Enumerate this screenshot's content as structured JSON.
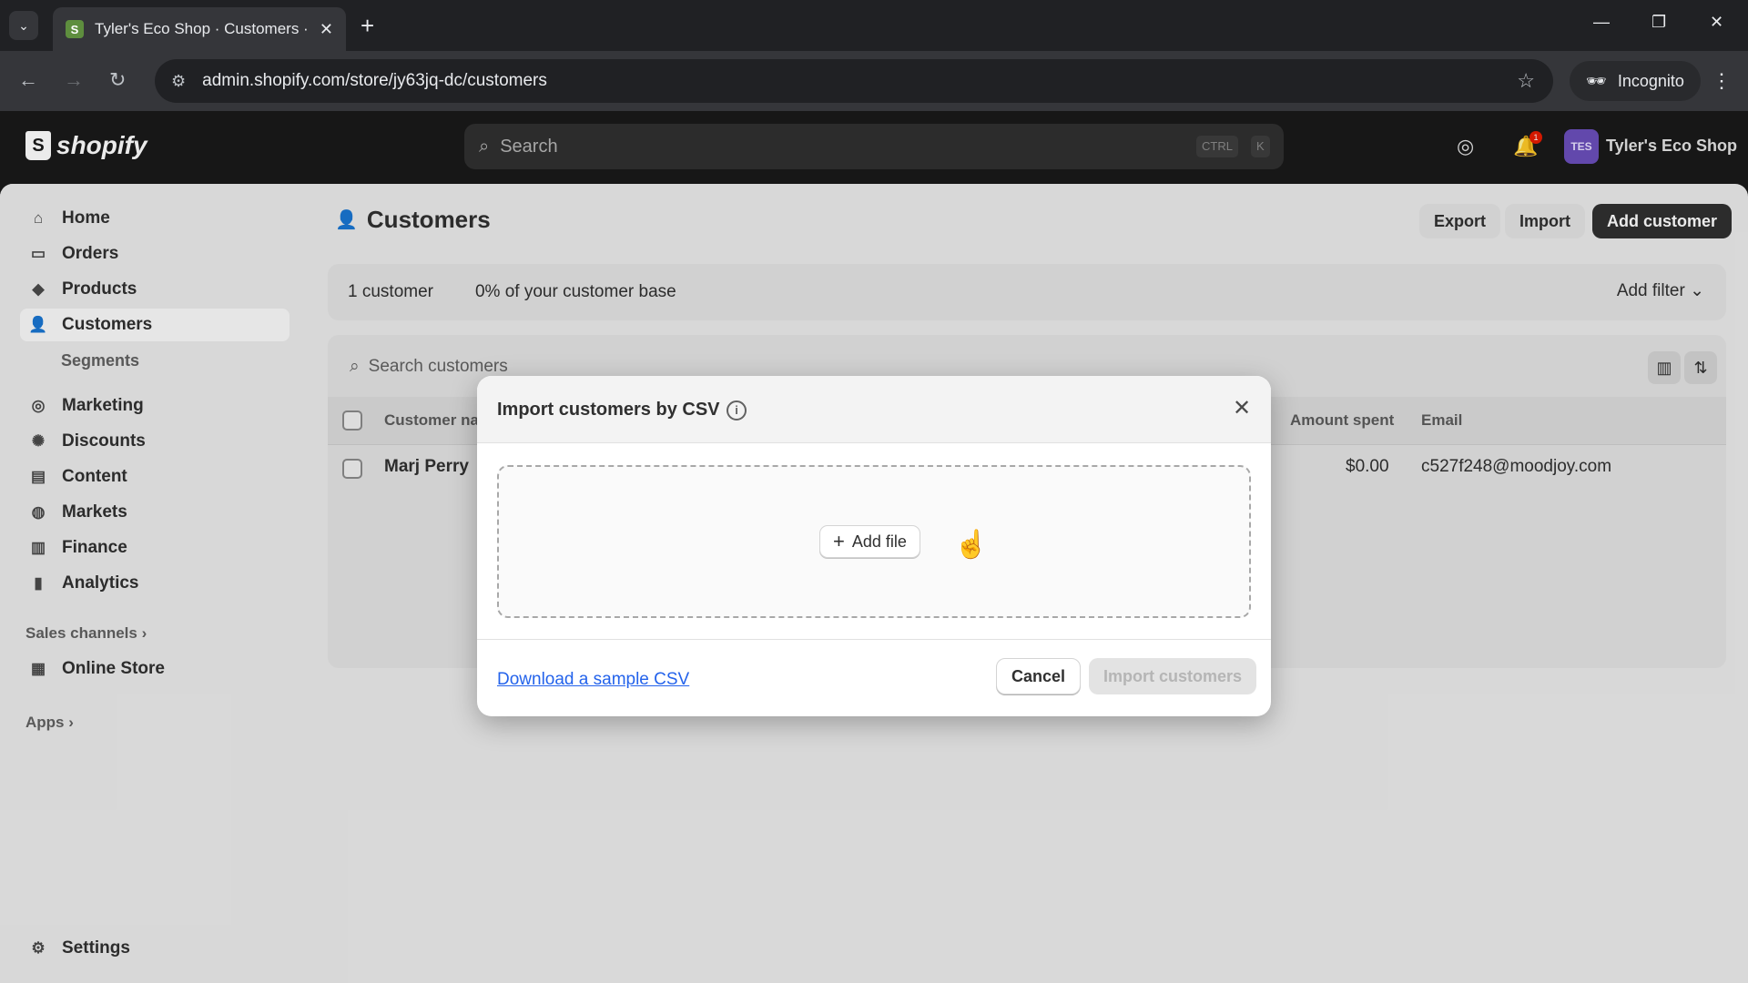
{
  "browser": {
    "tab_title": "Tyler's Eco Shop · Customers · S",
    "url": "admin.shopify.com/store/jy63jq-dc/customers",
    "incognito_label": "Incognito"
  },
  "topbar": {
    "logo_text": "shopify",
    "search_placeholder": "Search",
    "shortcut_ctrl": "CTRL",
    "shortcut_k": "K",
    "notification_count": "1",
    "store_initials": "TES",
    "store_name": "Tyler's Eco Shop"
  },
  "sidebar": {
    "items": [
      {
        "label": "Home",
        "icon": "home-icon"
      },
      {
        "label": "Orders",
        "icon": "inbox-icon"
      },
      {
        "label": "Products",
        "icon": "tag-icon"
      },
      {
        "label": "Customers",
        "icon": "person-icon"
      },
      {
        "label": "Marketing",
        "icon": "target-icon"
      },
      {
        "label": "Discounts",
        "icon": "discount-icon"
      },
      {
        "label": "Content",
        "icon": "content-icon"
      },
      {
        "label": "Markets",
        "icon": "globe-icon"
      },
      {
        "label": "Finance",
        "icon": "bank-icon"
      },
      {
        "label": "Analytics",
        "icon": "bar-chart-icon"
      }
    ],
    "sub_segments": "Segments",
    "sales_channels_label": "Sales channels",
    "online_store": "Online Store",
    "apps_label": "Apps",
    "settings": "Settings"
  },
  "page": {
    "title": "Customers",
    "export_label": "Export",
    "import_label": "Import",
    "add_customer_label": "Add customer",
    "customer_count": "1 customer",
    "customer_base": "0% of your customer base",
    "add_filter": "Add filter",
    "search_placeholder": "Search customers"
  },
  "table": {
    "headers": {
      "name": "Customer na",
      "amount": "Amount spent",
      "email": "Email"
    },
    "rows": [
      {
        "name": "Marj Perry",
        "amount": "$0.00",
        "email": "c527f248@moodjoy.com"
      }
    ]
  },
  "modal": {
    "title": "Import customers by CSV",
    "add_file": "Add file",
    "download_link": "Download a sample CSV",
    "cancel": "Cancel",
    "import": "Import customers"
  }
}
